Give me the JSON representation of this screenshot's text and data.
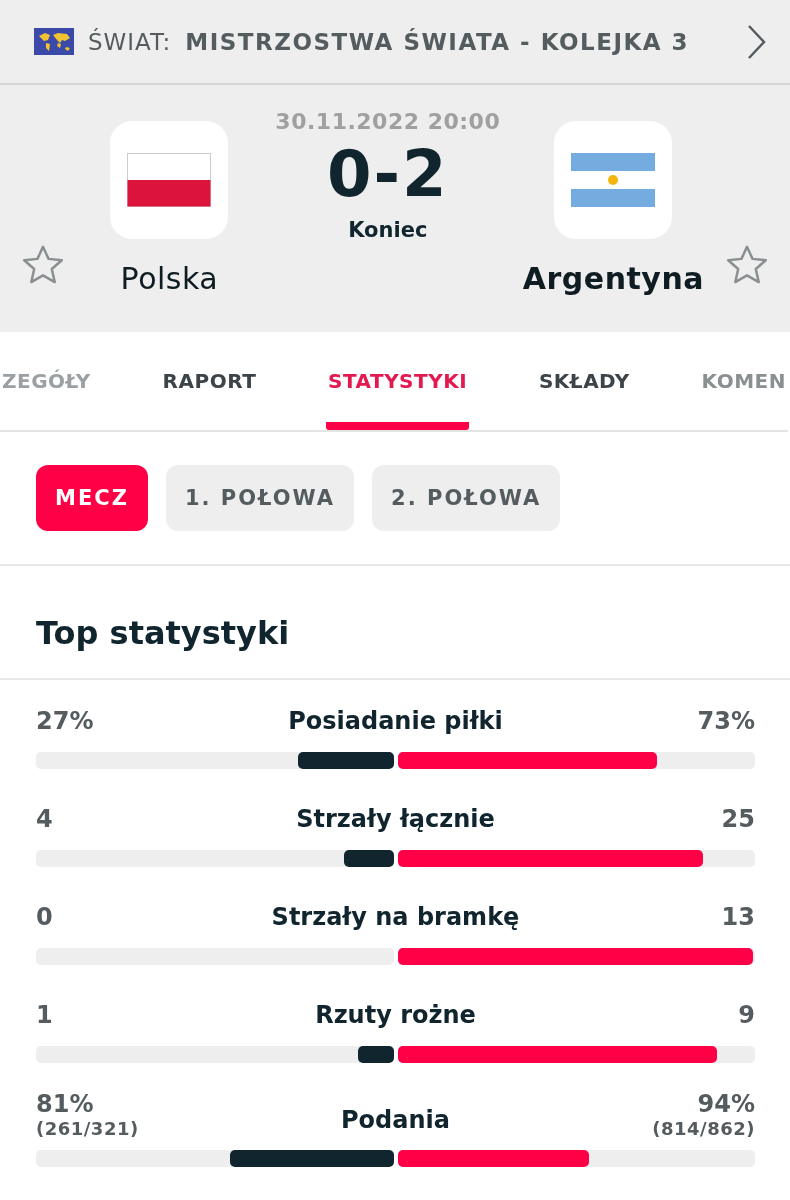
{
  "league": {
    "category": "ŚWIAT:",
    "name": "MISTRZOSTWA ŚWIATA - KOLEJKA 3"
  },
  "match": {
    "datetime": "30.11.2022 20:00",
    "score": "0-2",
    "status": "Koniec",
    "home": {
      "name": "Polska",
      "winner": false
    },
    "away": {
      "name": "Argentyna",
      "winner": true
    }
  },
  "tabs": [
    {
      "label": "ZEGÓŁY",
      "selected": false
    },
    {
      "label": "RAPORT",
      "selected": false
    },
    {
      "label": "STATYSTYKI",
      "selected": true
    },
    {
      "label": "SKŁADY",
      "selected": false
    },
    {
      "label": "KOMEN",
      "selected": false
    }
  ],
  "periods": [
    {
      "label": "MECZ",
      "selected": true
    },
    {
      "label": "1. POŁOWA",
      "selected": false
    },
    {
      "label": "2. POŁOWA",
      "selected": false
    }
  ],
  "section_title": "Top statystyki",
  "stats": [
    {
      "name": "Posiadanie piłki",
      "home": {
        "value": "27%",
        "level": 0.27
      },
      "away": {
        "value": "73%",
        "level": 0.73
      }
    },
    {
      "name": "Strzały łącznie",
      "home": {
        "value": "4",
        "level": 0.14
      },
      "away": {
        "value": "25",
        "level": 0.86
      }
    },
    {
      "name": "Strzały na bramkę",
      "home": {
        "value": "0",
        "level": 0
      },
      "away": {
        "value": "13",
        "level": 1
      }
    },
    {
      "name": "Rzuty rożne",
      "home": {
        "value": "1",
        "level": 0.1
      },
      "away": {
        "value": "9",
        "level": 0.9
      }
    },
    {
      "name": "Podania",
      "home": {
        "value": "81%",
        "detail": "(261/321)",
        "level": 0.46
      },
      "away": {
        "value": "94%",
        "detail": "(814/862)",
        "level": 0.54
      }
    }
  ]
}
